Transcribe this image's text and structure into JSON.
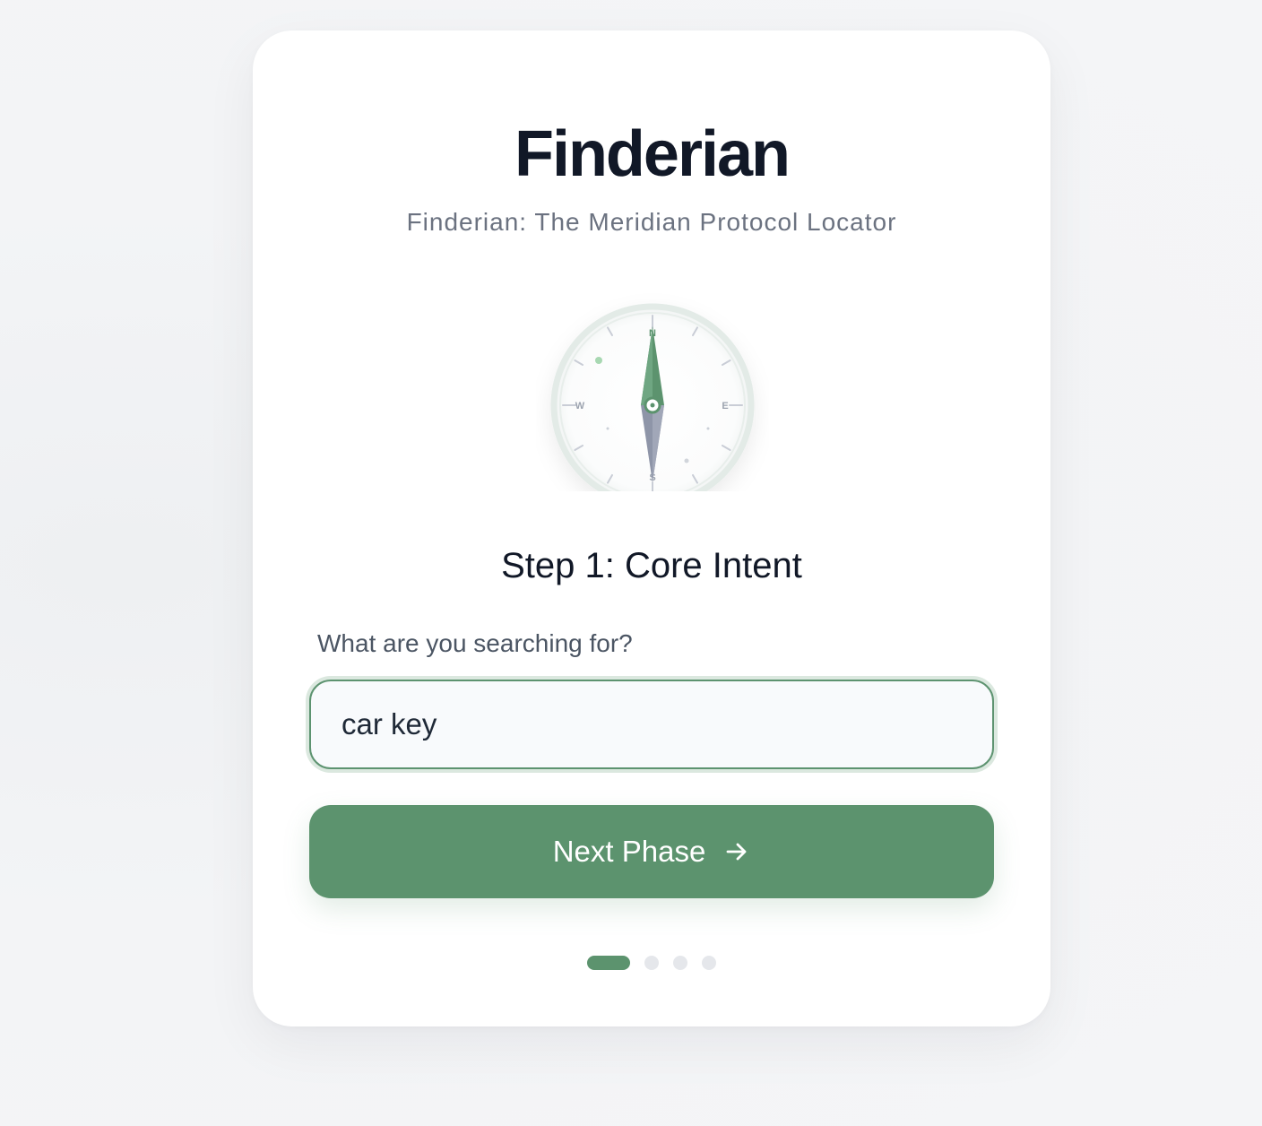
{
  "app": {
    "title": "Finderian",
    "subtitle": "Finderian: The Meridian Protocol Locator"
  },
  "compass": {
    "north_label": "N",
    "south_label": "S",
    "east_label": "E",
    "west_label": "W",
    "needle_color": "#5c936e",
    "tail_color": "#8e95a8"
  },
  "step": {
    "title": "Step 1: Core Intent",
    "question_label": "What are you searching for?",
    "input_value": "car key",
    "next_label": "Next Phase",
    "next_icon": "arrow-right-icon"
  },
  "progress": {
    "current_step": 1,
    "total_steps": 4
  },
  "colors": {
    "accent": "#5c936e",
    "text_primary": "#111827",
    "text_secondary": "#6b7280",
    "background": "#f3f4f6"
  }
}
